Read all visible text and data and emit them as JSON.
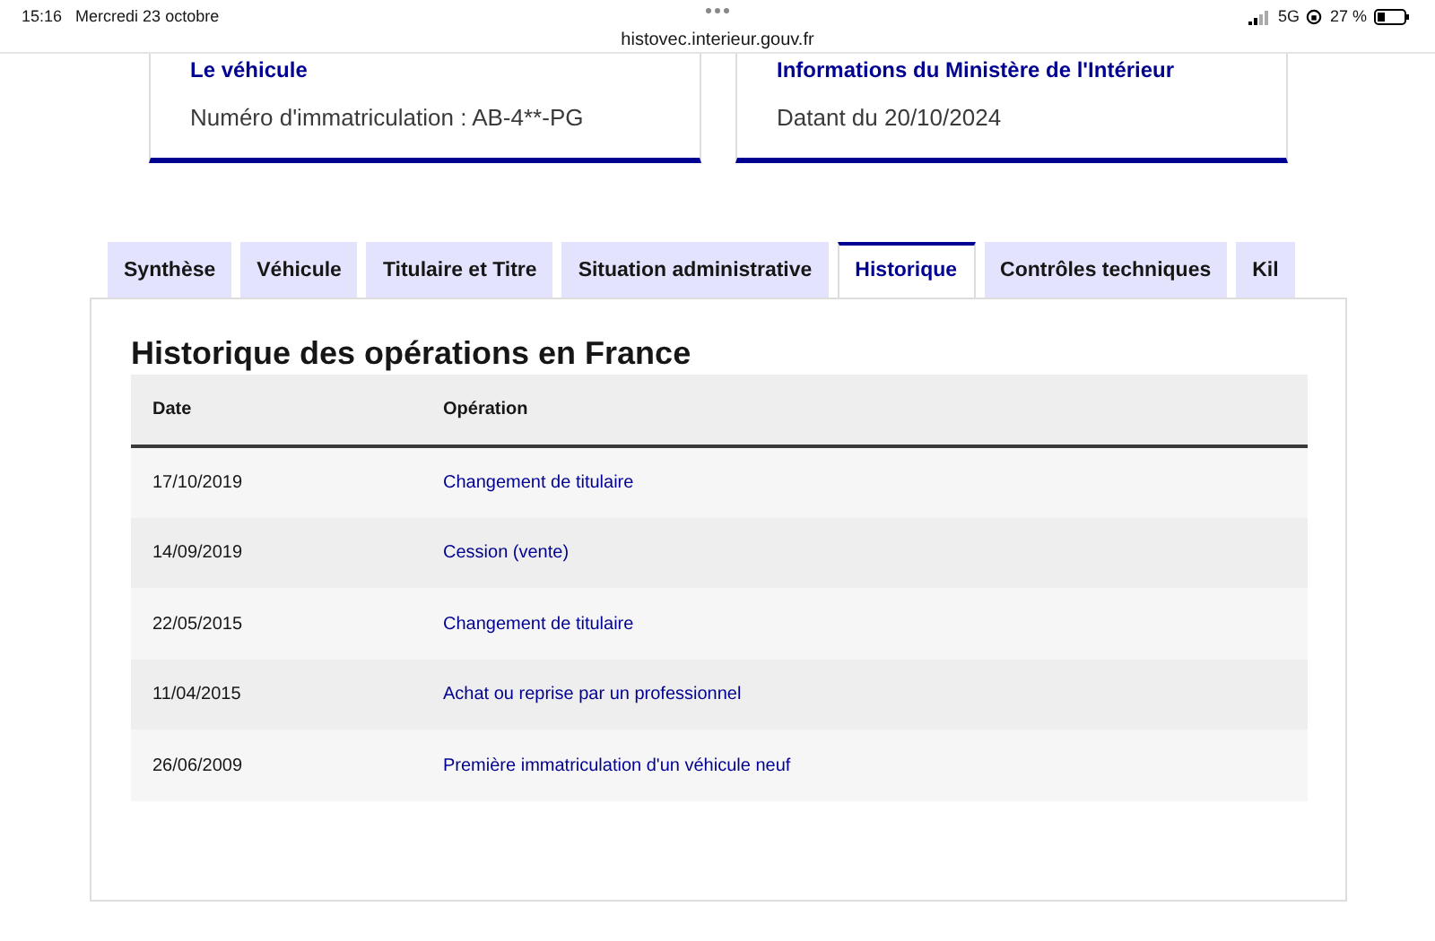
{
  "status_bar": {
    "time": "15:16",
    "date": "Mercredi 23 octobre",
    "url": "histovec.interieur.gouv.fr",
    "network": "5G",
    "battery": "27 %"
  },
  "cards": [
    {
      "title": "Le véhicule",
      "text": "Numéro d'immatriculation : AB-4**-PG"
    },
    {
      "title": "Informations du Ministère de l'Intérieur",
      "text": "Datant du 20/10/2024"
    }
  ],
  "tabs": [
    {
      "label": "Synthèse",
      "selected": false
    },
    {
      "label": "Véhicule",
      "selected": false
    },
    {
      "label": "Titulaire et Titre",
      "selected": false
    },
    {
      "label": "Situation administrative",
      "selected": false
    },
    {
      "label": "Historique",
      "selected": true
    },
    {
      "label": "Contrôles techniques",
      "selected": false
    },
    {
      "label": "Kil",
      "selected": false
    }
  ],
  "panel": {
    "title": "Historique des opérations en France",
    "table": {
      "columns": [
        "Date",
        "Opération"
      ],
      "rows": [
        [
          "17/10/2019",
          "Changement de titulaire"
        ],
        [
          "14/09/2019",
          "Cession (vente)"
        ],
        [
          "22/05/2015",
          "Changement de titulaire"
        ],
        [
          "11/04/2015",
          "Achat ou reprise par un professionnel"
        ],
        [
          "26/06/2009",
          "Première immatriculation d'un véhicule neuf"
        ]
      ]
    }
  }
}
